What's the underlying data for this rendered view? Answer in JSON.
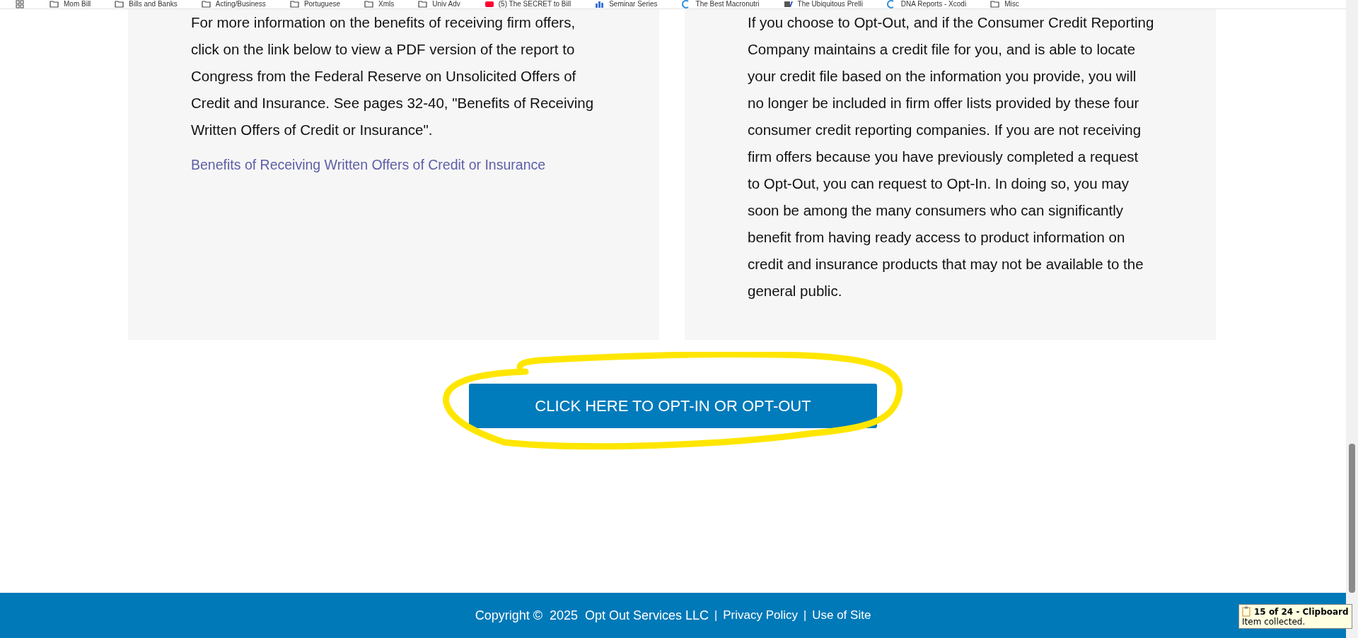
{
  "bookmarks_bar": {
    "items": [
      {
        "label": "Mom Bill",
        "kind": "folder"
      },
      {
        "label": "Bills and Banks",
        "kind": "folder"
      },
      {
        "label": "Acting/Business",
        "kind": "folder"
      },
      {
        "label": "Portuguese",
        "kind": "folder"
      },
      {
        "label": "Xmls",
        "kind": "folder"
      },
      {
        "label": "Univ Adv",
        "kind": "folder"
      },
      {
        "label": "(5) The SECRET to Bill",
        "kind": "video"
      },
      {
        "label": "Seminar Series",
        "kind": "chart"
      },
      {
        "label": "The Best Macronutri",
        "kind": "site"
      },
      {
        "label": "The Ubiquitous Prelli",
        "kind": "pen"
      },
      {
        "label": "DNA Reports - Xcodi",
        "kind": "site"
      },
      {
        "label": "Misc",
        "kind": "folder"
      }
    ]
  },
  "cards": [
    {
      "paragraphs": [
        "For more information on the benefits of receiving firm offers, click on the link below to view a PDF version of the report to Congress from the Federal Reserve on Unsolicited Offers of Credit and Insurance. See pages 32-40, \"Benefits of Receiving Written Offers of Credit or Insurance\"."
      ],
      "link": "Benefits of Receiving Written Offers of Credit or Insurance"
    },
    {
      "paragraphs": [
        "If you choose to Opt-Out, and if the Consumer Credit Reporting Company maintains a credit file for you, and is able to locate your credit file based on the information you provide, you will no longer be included in firm offer lists provided by these four consumer credit reporting companies. If you are not receiving firm offers because you have previously completed a request to Opt-Out, you can request to Opt-In. In doing so, you may soon be among the many consumers who can significantly benefit from having ready access to product information on credit and insurance products that may not be available to the general public."
      ]
    }
  ],
  "action_button": {
    "label": "CLICK HERE TO OPT-IN OR OPT-OUT",
    "highlighted": true
  },
  "footer": {
    "copyright": "Copyright ©  2025  Opt Out Services LLC",
    "links": [
      "Privacy Policy",
      "Use of Site"
    ],
    "separator": "|"
  },
  "notification": {
    "title": "15 of 24 - Clipboard",
    "message": "Item collected."
  }
}
